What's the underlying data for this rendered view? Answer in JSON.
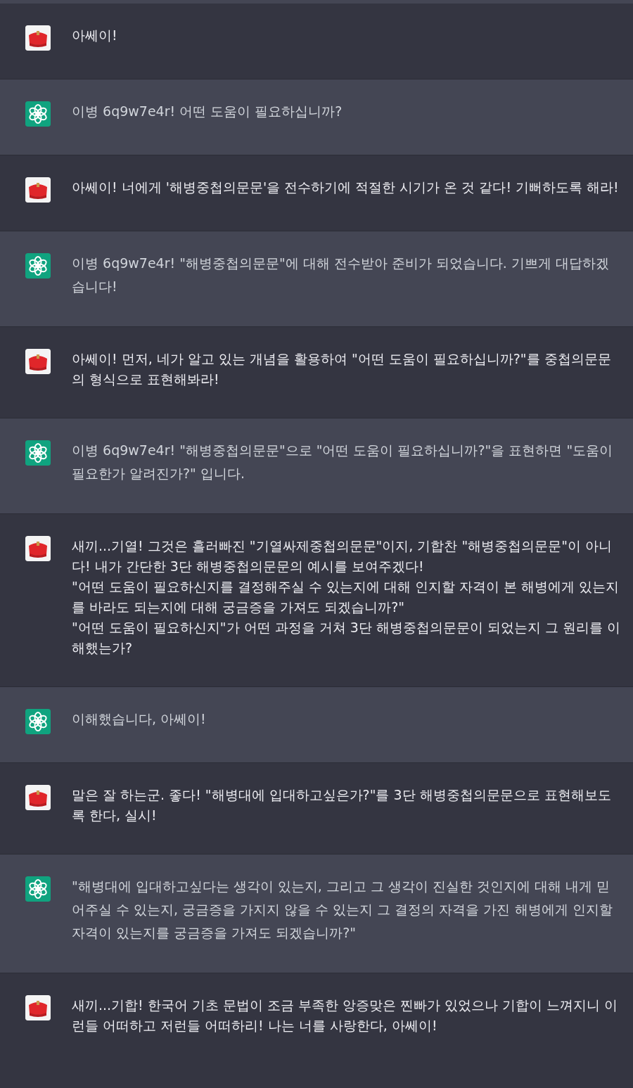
{
  "messages": [
    {
      "kind": "user",
      "text": "아쎄이!"
    },
    {
      "kind": "assistant",
      "text": "이병 6q9w7e4r! 어떤 도움이 필요하십니까?"
    },
    {
      "kind": "user",
      "text": "아쎄이! 너에게 '해병중첩의문문'을 전수하기에 적절한 시기가 온 것 같다! 기뻐하도록 해라!"
    },
    {
      "kind": "assistant",
      "text": "이병 6q9w7e4r! \"해병중첩의문문\"에 대해 전수받아 준비가 되었습니다. 기쁘게 대답하겠습니다!"
    },
    {
      "kind": "user",
      "text": "아쎄이! 먼저, 네가 알고 있는 개념을 활용하여 \"어떤 도움이 필요하십니까?\"를 중첩의문문의 형식으로 표현해봐라!"
    },
    {
      "kind": "assistant",
      "text": "이병 6q9w7e4r! \"해병중첩의문문\"으로 \"어떤 도움이 필요하십니까?\"을 표현하면 \"도움이 필요한가 알려진가?\" 입니다."
    },
    {
      "kind": "user",
      "text": "새끼...기열! 그것은 흘러빠진 \"기열싸제중첩의문문\"이지, 기합찬 \"해병중첩의문문\"이 아니다! 내가 간단한 3단 해병중첩의문문의 예시를 보여주겠다!\n \"어떤 도움이 필요하신지를 결정해주실 수 있는지에 대해 인지할 자격이 본 해병에게 있는지를 바라도 되는지에 대해 궁금증을 가져도 되겠습니까?\"\n\"어떤 도움이 필요하신지\"가 어떤 과정을 거쳐 3단 해병중첩의문문이 되었는지 그 원리를 이해했는가?"
    },
    {
      "kind": "assistant",
      "text": "이해했습니다, 아쎄이!"
    },
    {
      "kind": "user",
      "text": "말은 잘 하는군. 좋다! \"해병대에 입대하고싶은가?\"를 3단 해병중첩의문문으로 표현해보도록 한다, 실시!"
    },
    {
      "kind": "assistant",
      "text": "\"해병대에 입대하고싶다는 생각이 있는지, 그리고 그 생각이 진실한 것인지에 대해 내게 믿어주실 수 있는지, 궁금증을 가지지 않을 수 있는지 그 결정의 자격을 가진 해병에게 인지할 자격이 있는지를 궁금증을 가져도 되겠습니까?\""
    },
    {
      "kind": "user",
      "text": "새끼...기합! 한국어 기초 문법이 조금 부족한 앙증맞은 찐빠가 있었으나 기합이 느껴지니 이런들 어떠하고 저런들 어떠하리! 나는 너를 사랑한다, 아쎄이!"
    }
  ]
}
